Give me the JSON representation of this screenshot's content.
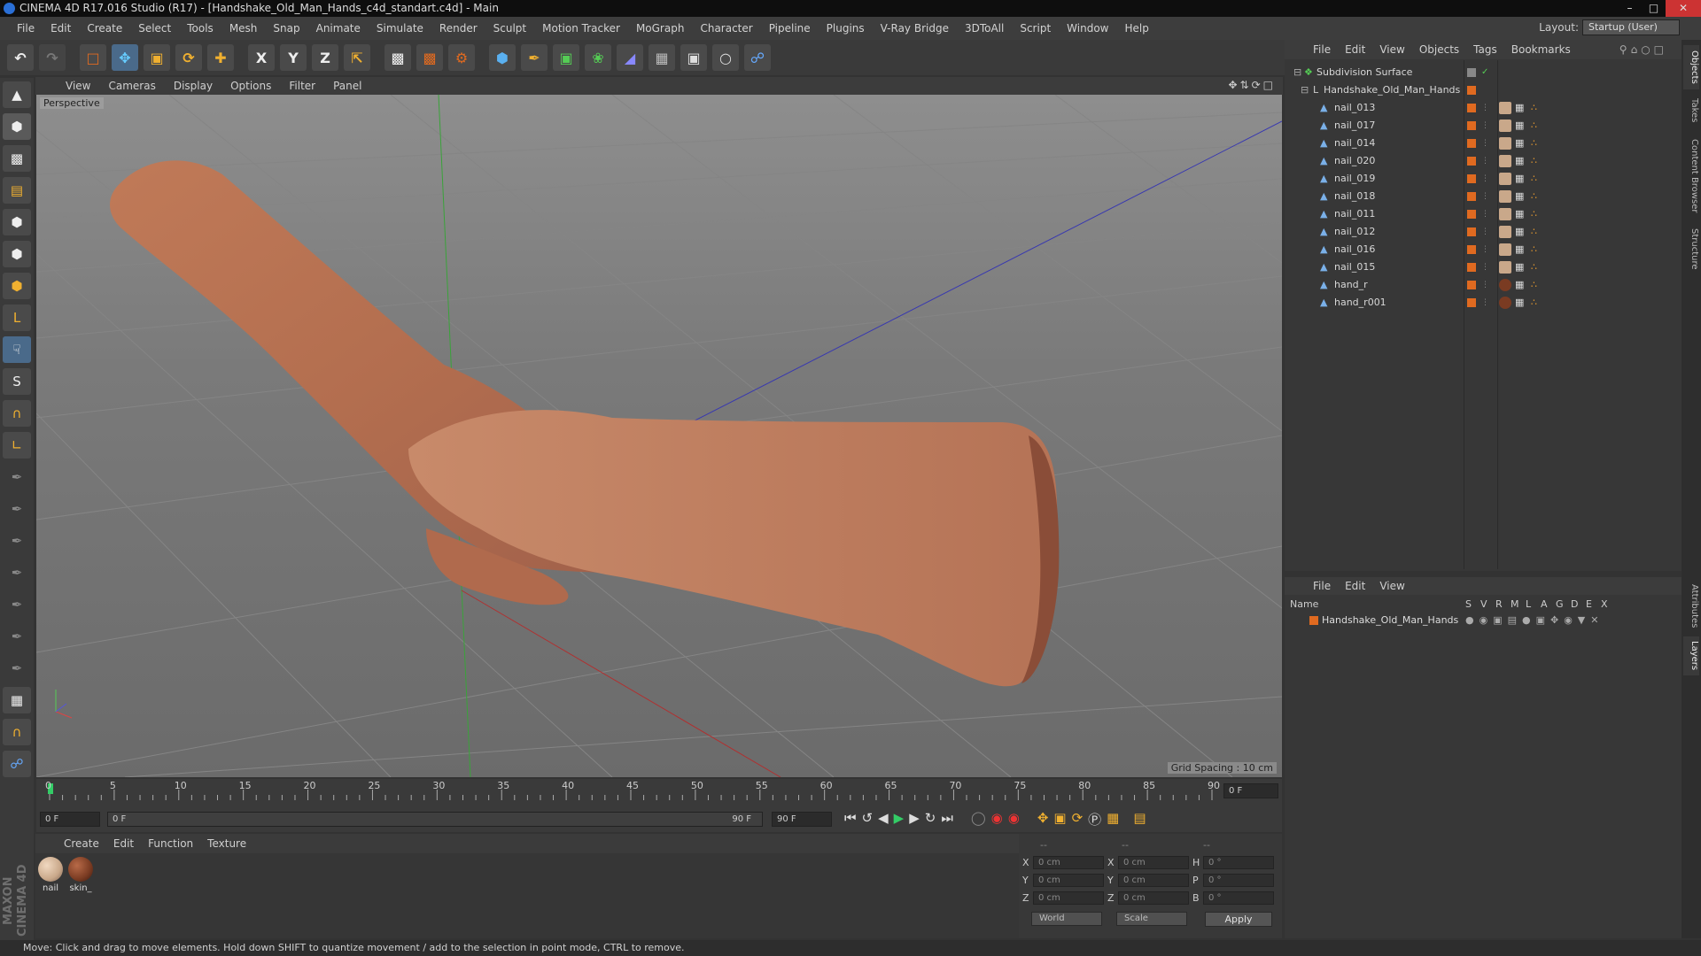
{
  "window": {
    "title": "CINEMA 4D R17.016 Studio (R17) - [Handshake_Old_Man_Hands_c4d_standart.c4d] - Main"
  },
  "menubar": [
    "File",
    "Edit",
    "Create",
    "Select",
    "Tools",
    "Mesh",
    "Snap",
    "Animate",
    "Simulate",
    "Render",
    "Sculpt",
    "Motion Tracker",
    "MoGraph",
    "Character",
    "Pipeline",
    "Plugins",
    "V-Ray Bridge",
    "3DToAll",
    "Script",
    "Window",
    "Help"
  ],
  "layout": {
    "label": "Layout:",
    "value": "Startup (User)"
  },
  "toolbar": {
    "axis_x": "X",
    "axis_y": "Y",
    "axis_z": "Z"
  },
  "viewport": {
    "menu": [
      "View",
      "Cameras",
      "Display",
      "Options",
      "Filter",
      "Panel"
    ],
    "label": "Perspective",
    "grid_spacing": "Grid Spacing : 10 cm"
  },
  "timeline": {
    "ticks": [
      "0",
      "5",
      "10",
      "15",
      "20",
      "25",
      "30",
      "35",
      "40",
      "45",
      "50",
      "55",
      "60",
      "65",
      "70",
      "75",
      "80",
      "85",
      "90"
    ],
    "current_frame": "0 F",
    "start_field": "0 F",
    "range_start": "0 F",
    "range_end": "90 F",
    "end_field": "90 F"
  },
  "material_panel": {
    "menu": [
      "Create",
      "Edit",
      "Function",
      "Texture"
    ],
    "materials": [
      {
        "name": "nail",
        "color": "#c9a88a"
      },
      {
        "name": "skin_",
        "color": "#7a3b22"
      }
    ]
  },
  "coords": {
    "header": [
      "--",
      "--",
      "--"
    ],
    "rows": [
      {
        "a": "X",
        "av": "0 cm",
        "b": "X",
        "bv": "0 cm",
        "c": "H",
        "cv": "0 °"
      },
      {
        "a": "Y",
        "av": "0 cm",
        "b": "Y",
        "bv": "0 cm",
        "c": "P",
        "cv": "0 °"
      },
      {
        "a": "Z",
        "av": "0 cm",
        "b": "Z",
        "bv": "0 cm",
        "c": "B",
        "cv": "0 °"
      }
    ],
    "world": "World",
    "scale": "Scale",
    "apply": "Apply"
  },
  "object_manager": {
    "menu": [
      "File",
      "Edit",
      "View",
      "Objects",
      "Tags",
      "Bookmarks"
    ],
    "root": "Subdivision Surface",
    "group": "Handshake_Old_Man_Hands",
    "objects": [
      "nail_013",
      "nail_017",
      "nail_014",
      "nail_020",
      "nail_019",
      "nail_018",
      "nail_011",
      "nail_012",
      "nail_016",
      "nail_015",
      "hand_r",
      "hand_r001"
    ]
  },
  "layer_manager": {
    "menu": [
      "File",
      "Edit",
      "View"
    ],
    "columns": [
      "Name",
      "S",
      "V",
      "R",
      "M",
      "L",
      "A",
      "G",
      "D",
      "E",
      "X"
    ],
    "layer": "Handshake_Old_Man_Hands"
  },
  "right_tabs": [
    "Objects",
    "Takes",
    "Content Browser",
    "Structure",
    "Attributes",
    "Layers"
  ],
  "brand": "MAXON CINEMA 4D",
  "status": "Move: Click and drag to move elements. Hold down SHIFT to quantize movement / add to the selection in point mode, CTRL to remove."
}
